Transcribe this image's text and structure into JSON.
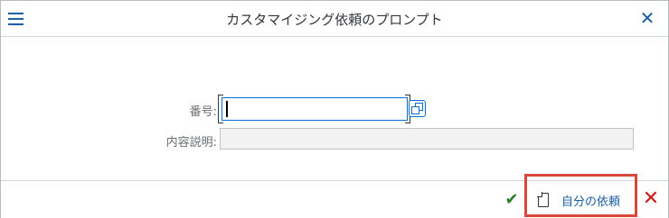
{
  "dialog": {
    "title": "カスタマイジング依頼のプロンプト",
    "menu_icon": "hamburger-menu-icon",
    "close_icon": "close-icon"
  },
  "form": {
    "number_label": "番号:",
    "number_value": "",
    "description_label": "内容説明:",
    "description_value": "",
    "value_help_icon": "value-help-icon"
  },
  "footer": {
    "confirm_icon": "checkmark-icon",
    "my_requests_label": "自分の依頼",
    "my_requests_icon": "document-icon",
    "cancel_icon": "cancel-icon"
  },
  "colors": {
    "accent": "#0a6ed1",
    "confirm": "#2b7d2b",
    "cancel": "#cc1919",
    "highlight": "#d9473b"
  }
}
